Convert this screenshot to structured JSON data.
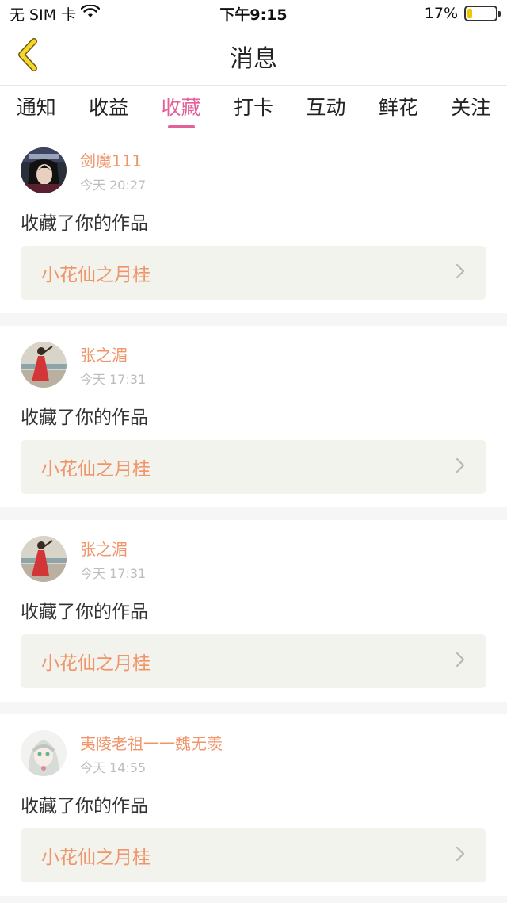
{
  "status_bar": {
    "carrier": "无 SIM 卡",
    "time": "下午9:15",
    "battery": "17%",
    "battery_level": 0.17
  },
  "navbar": {
    "back_icon": "chevron-left-icon",
    "title": "消息"
  },
  "tabs": [
    {
      "label": "通知",
      "active": false
    },
    {
      "label": "收益",
      "active": false
    },
    {
      "label": "收藏",
      "active": true
    },
    {
      "label": "打卡",
      "active": false
    },
    {
      "label": "互动",
      "active": false
    },
    {
      "label": "鲜花",
      "active": false
    },
    {
      "label": "关注",
      "active": false
    }
  ],
  "messages": [
    {
      "username": "剑魔111",
      "time": "今天 20:27",
      "action": "收藏了你的作品",
      "work": "小花仙之月桂"
    },
    {
      "username": "张之湄",
      "time": "今天 17:31",
      "action": "收藏了你的作品",
      "work": "小花仙之月桂"
    },
    {
      "username": "张之湄",
      "time": "今天 17:31",
      "action": "收藏了你的作品",
      "work": "小花仙之月桂"
    },
    {
      "username": "夷陵老祖一一魏无羡",
      "time": "今天 14:55",
      "action": "收藏了你的作品",
      "work": "小花仙之月桂"
    }
  ],
  "colors": {
    "accent": "#e2619a",
    "username": "#f0956a",
    "work_link_bg": "#f3f3ee"
  }
}
